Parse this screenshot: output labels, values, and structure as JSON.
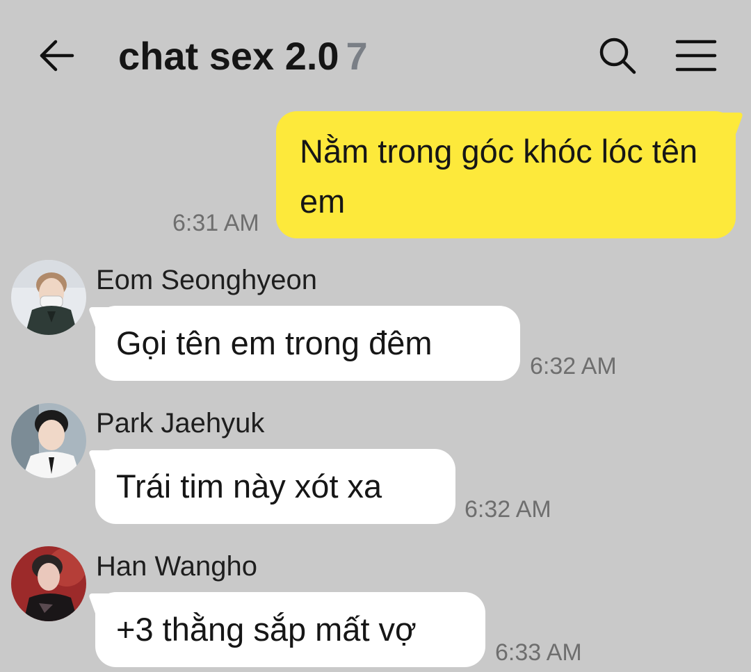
{
  "header": {
    "title": "chat sex 2.0",
    "member_count": "7",
    "back_icon": "back-arrow-icon",
    "search_icon": "search-icon",
    "menu_icon": "menu-icon"
  },
  "messages": [
    {
      "sender": "me",
      "text": "Nằm trong góc khóc lóc tên em",
      "time": "6:31 AM"
    },
    {
      "sender": "Eom Seonghyeon",
      "text": "Gọi tên em trong đêm",
      "time": "6:32 AM"
    },
    {
      "sender": "Park Jaehyuk",
      "text": "Trái tim này xót xa",
      "time": "6:32 AM"
    },
    {
      "sender": "Han Wangho",
      "text": "+3 thằng sắp mất vợ",
      "time": "6:33 AM"
    }
  ],
  "colors": {
    "background": "#c9c9c9",
    "my_bubble": "#fde93b",
    "other_bubble": "#ffffff",
    "member_count": "#7a7f86"
  }
}
